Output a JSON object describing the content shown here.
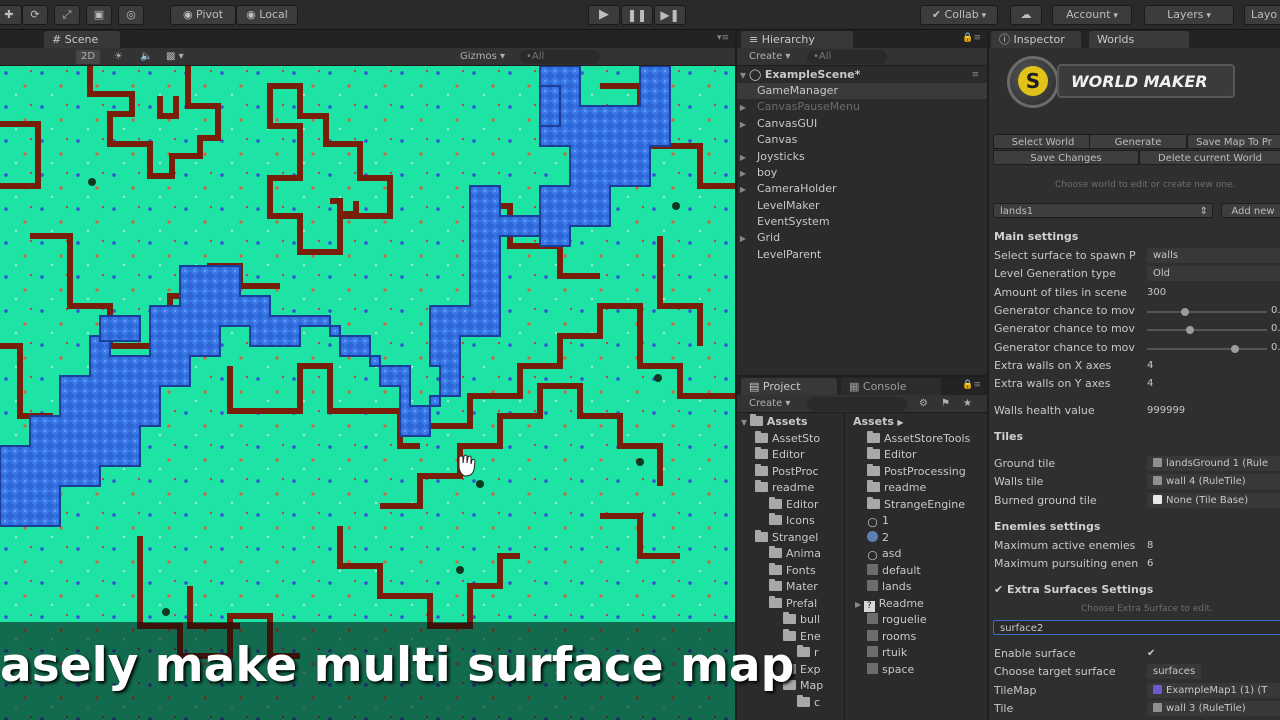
{
  "toolbar": {
    "pivot": "Pivot",
    "local": "Local",
    "collab": "Collab",
    "account": "Account",
    "layers": "Layers",
    "layout": "Layo"
  },
  "scene": {
    "tab": "Scene",
    "mode_2d": "2D",
    "gizmos": "Gizmos",
    "search": "•All"
  },
  "hierarchy": {
    "tab": "Hierarchy",
    "create": "Create",
    "search": "•All",
    "items": [
      {
        "label": "ExampleScene*",
        "state": "scene"
      },
      {
        "label": "GameManager",
        "state": "selected"
      },
      {
        "label": "CanvasPauseMenu",
        "state": "disabled"
      },
      {
        "label": "CanvasGUI",
        "state": "collapsed"
      },
      {
        "label": "Canvas",
        "state": "none"
      },
      {
        "label": "Joysticks",
        "state": "collapsed"
      },
      {
        "label": "boy",
        "state": "collapsed"
      },
      {
        "label": "CameraHolder",
        "state": "collapsed"
      },
      {
        "label": "LevelMaker",
        "state": "none"
      },
      {
        "label": "EventSystem",
        "state": "none"
      },
      {
        "label": "Grid",
        "state": "collapsed"
      },
      {
        "label": "LevelParent",
        "state": "none"
      }
    ]
  },
  "project": {
    "tab_project": "Project",
    "tab_console": "Console",
    "create": "Create",
    "left_header": "Assets",
    "right_header": "Assets",
    "tree": [
      {
        "label": "AssetSto",
        "depth": 1
      },
      {
        "label": "Editor",
        "depth": 1
      },
      {
        "label": "PostProc",
        "depth": 1
      },
      {
        "label": "readme",
        "depth": 1
      },
      {
        "label": "Editor",
        "depth": 2
      },
      {
        "label": "Icons",
        "depth": 2
      },
      {
        "label": "Strangel",
        "depth": 1
      },
      {
        "label": "Anima",
        "depth": 2
      },
      {
        "label": "Fonts",
        "depth": 2
      },
      {
        "label": "Mater",
        "depth": 2
      },
      {
        "label": "Prefal",
        "depth": 2
      },
      {
        "label": "bull",
        "depth": 3
      },
      {
        "label": "Ene",
        "depth": 3
      },
      {
        "label": "r",
        "depth": 4
      },
      {
        "label": "Exp",
        "depth": 3
      },
      {
        "label": "Map",
        "depth": 3
      },
      {
        "label": "c",
        "depth": 4
      }
    ],
    "files": [
      {
        "label": "AssetStoreTools",
        "icon": "folder"
      },
      {
        "label": "Editor",
        "icon": "folder"
      },
      {
        "label": "PostProcessing",
        "icon": "folder"
      },
      {
        "label": "readme",
        "icon": "folder"
      },
      {
        "label": "StrangeEngine",
        "icon": "folder"
      },
      {
        "label": "1",
        "icon": "scene"
      },
      {
        "label": "2",
        "icon": "sphere"
      },
      {
        "label": "asd",
        "icon": "scene"
      },
      {
        "label": "default",
        "icon": "asset"
      },
      {
        "label": "lands",
        "icon": "asset"
      },
      {
        "label": "Readme",
        "icon": "question"
      },
      {
        "label": "roguelie",
        "icon": "asset"
      },
      {
        "label": "rooms",
        "icon": "asset"
      },
      {
        "label": "rtuik",
        "icon": "asset"
      },
      {
        "label": "space",
        "icon": "asset"
      }
    ]
  },
  "inspector": {
    "tab_inspector": "Inspector",
    "tab_worlds": "Worlds",
    "logo_letter": "S",
    "logo_text": "WORLD MAKER",
    "buttons": {
      "select_world": "Select World",
      "generate": "Generate",
      "save_map": "Save Map To Pr",
      "save_changes": "Save Changes",
      "delete_world": "Delete current World"
    },
    "hint_choose_world": "Choose world to edit or create new one.",
    "world_select": "lands1",
    "add_new": "Add new",
    "main_settings": "Main settings",
    "main_rows": [
      {
        "label": "Select surface to spawn P",
        "value": "walls",
        "kind": "field"
      },
      {
        "label": "Level Generation type",
        "value": "Old",
        "kind": "field"
      },
      {
        "label": "Amount of tiles in scene",
        "value": "300",
        "kind": "plain"
      },
      {
        "label": "Generator chance to mov",
        "value": "0.",
        "kind": "slider",
        "pos": 0.3
      },
      {
        "label": "Generator chance to mov",
        "value": "0.",
        "kind": "slider",
        "pos": 0.35
      },
      {
        "label": "Generator chance to mov",
        "value": "0.",
        "kind": "slider",
        "pos": 0.75
      },
      {
        "label": "Extra walls on X axes",
        "value": "4",
        "kind": "plain"
      },
      {
        "label": "Extra walls on Y axes",
        "value": "4",
        "kind": "plain"
      }
    ],
    "walls_health_label": "Walls health value",
    "walls_health_value": "999999",
    "tiles": "Tiles",
    "tiles_rows": [
      {
        "label": "Ground tile",
        "value": "landsGround 1 (Rule"
      },
      {
        "label": "Walls tile",
        "value": "wall 4 (RuleTile)"
      },
      {
        "label": "Burned ground tile",
        "value": "None (Tile Base)"
      }
    ],
    "enemies_settings": "Enemies settings",
    "enemies_rows": [
      {
        "label": "Maximum active enemies",
        "value": "8"
      },
      {
        "label": "Maximum pursuiting enen",
        "value": "6"
      }
    ],
    "extra_surfaces": "Extra Surfaces Settings",
    "hint_choose_surface": "Choose Extra Surface to edit.",
    "surface_field": "surface2",
    "extra_rows": [
      {
        "label": "Enable surface",
        "value": "✔",
        "kind": "check"
      },
      {
        "label": "Choose target surface",
        "value": "surfaces",
        "kind": "field"
      },
      {
        "label": "TileMap",
        "value": "ExampleMap1 (1) (T",
        "kind": "obj"
      },
      {
        "label": "Tile",
        "value": "wall 3 (RuleTile)",
        "kind": "obj"
      }
    ]
  },
  "caption": "asely make multi surface map",
  "colors": {
    "grass": "#1de3a4",
    "water": "#2e66d8",
    "wall": "#7a1e0c",
    "ui_dark": "#2b2b2b"
  }
}
